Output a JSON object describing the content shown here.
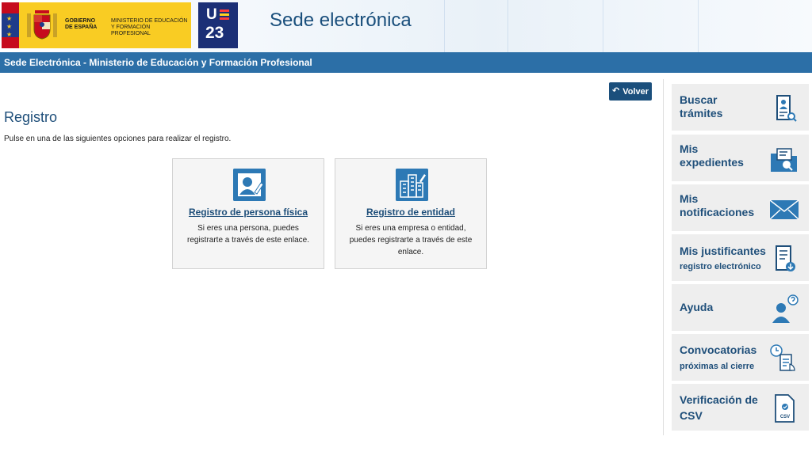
{
  "header": {
    "gov_text_1": "GOBIERNO DE ESPAÑA",
    "gov_text_2": "MINISTERIO DE EDUCACIÓN Y FORMACIÓN PROFESIONAL",
    "ue_top": "U",
    "ue_bottom": "23",
    "site_title": "Sede electrónica"
  },
  "bluebar": {
    "text": "Sede Electrónica - Ministerio de Educación y Formación Profesional"
  },
  "main": {
    "back_label": "Volver",
    "title": "Registro",
    "instructions": "Pulse en una de las siguientes opciones para realizar el registro.",
    "cards": [
      {
        "title": "Registro de persona física",
        "description": "Si eres una persona, puedes registrarte a través de este enlace.",
        "icon": "person-edit-icon"
      },
      {
        "title": "Registro de entidad",
        "description": "Si eres una empresa o entidad, puedes registrarte a través de este enlace.",
        "icon": "building-edit-icon"
      }
    ]
  },
  "sidebar": {
    "items": [
      {
        "line1": "Buscar",
        "line2": "trámites",
        "icon": "search-document-icon"
      },
      {
        "line1": "Mis",
        "line2": "expedientes",
        "icon": "folder-search-icon"
      },
      {
        "line1": "Mis",
        "line2": "notificaciones",
        "icon": "envelope-icon"
      },
      {
        "line1": "Mis justificantes",
        "line2": "registro electrónico",
        "icon": "receipt-download-icon"
      },
      {
        "line1": "Ayuda",
        "line2": "",
        "icon": "help-user-icon"
      },
      {
        "line1": "Convocatorias",
        "line2": "próximas al cierre",
        "icon": "clock-document-icon"
      },
      {
        "line1": "Verificación de",
        "line2": "CSV",
        "icon": "csv-document-icon"
      }
    ],
    "icon_labels": {
      "csv": "CSV"
    }
  },
  "colors": {
    "accent": "#2c6fa7",
    "dark_blue": "#1b4f7c",
    "title_blue": "#1f4f7a",
    "gov_yellow": "#f9cc23"
  }
}
